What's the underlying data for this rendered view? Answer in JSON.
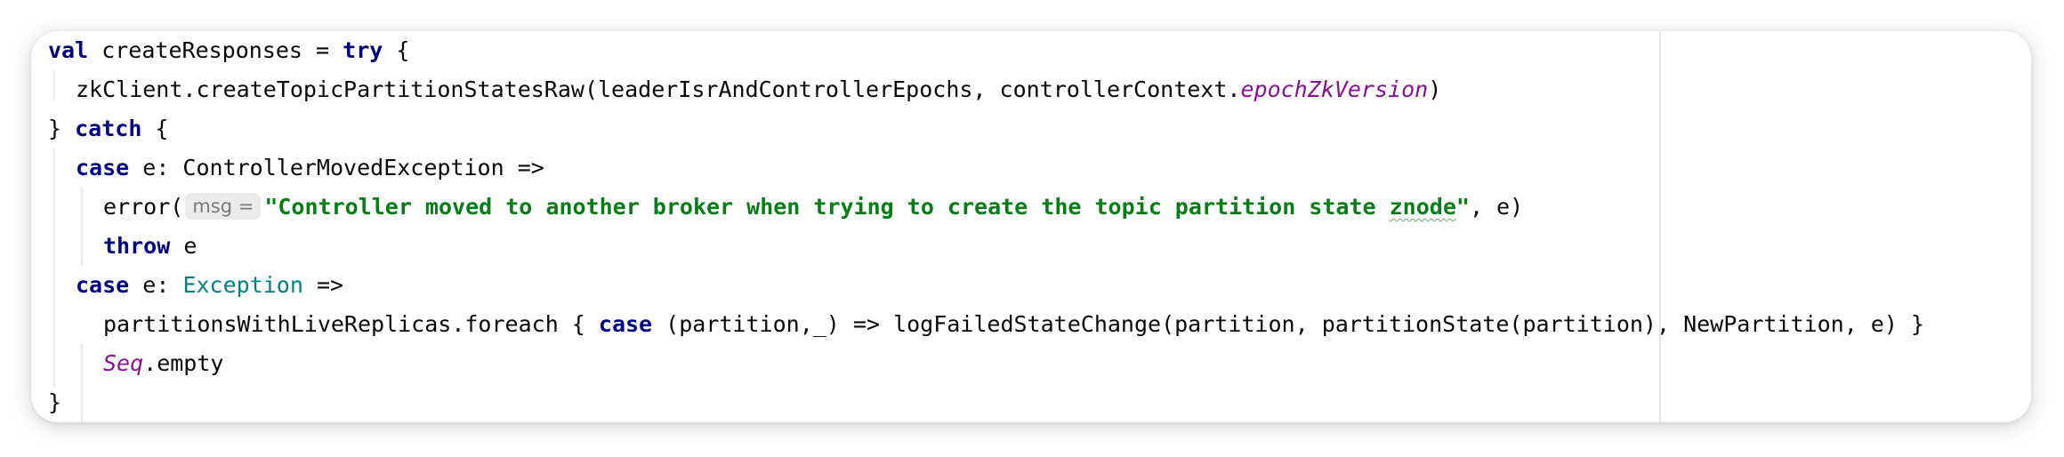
{
  "code": {
    "line1": {
      "kw_val": "val",
      "text_a": " createResponses = ",
      "kw_try": "try",
      "text_b": " {"
    },
    "line2": {
      "text_a": "zkClient.createTopicPartitionStatesRaw(leaderIsrAndControllerEpochs, controllerContext.",
      "member": "epochZkVersion",
      "text_b": ")"
    },
    "line3": {
      "text_a": "} ",
      "kw_catch": "catch",
      "text_b": " {"
    },
    "line4": {
      "kw_case": "case",
      "text_a": " e: ControllerMovedException =>"
    },
    "line5": {
      "text_a": "error(",
      "hint": "msg =",
      "str_a": "\"Controller moved to another broker when trying to create the topic partition state ",
      "str_typo": "znode",
      "str_b": "\"",
      "text_b": ", e)"
    },
    "line6": {
      "kw_throw": "throw",
      "text_a": " e"
    },
    "line7": {
      "kw_case": "case",
      "text_a": " e: ",
      "type": "Exception",
      "text_b": " =>"
    },
    "line8": {
      "text_a": "partitionsWithLiveReplicas.foreach { ",
      "kw_case": "case",
      "text_b": " (partition,_) => logFailedStateChange(partition, partitionState(partition), NewPartition, e) }"
    },
    "line9": {
      "obj": "Seq",
      "text_a": ".empty"
    },
    "line10": {
      "text_a": "}"
    }
  }
}
